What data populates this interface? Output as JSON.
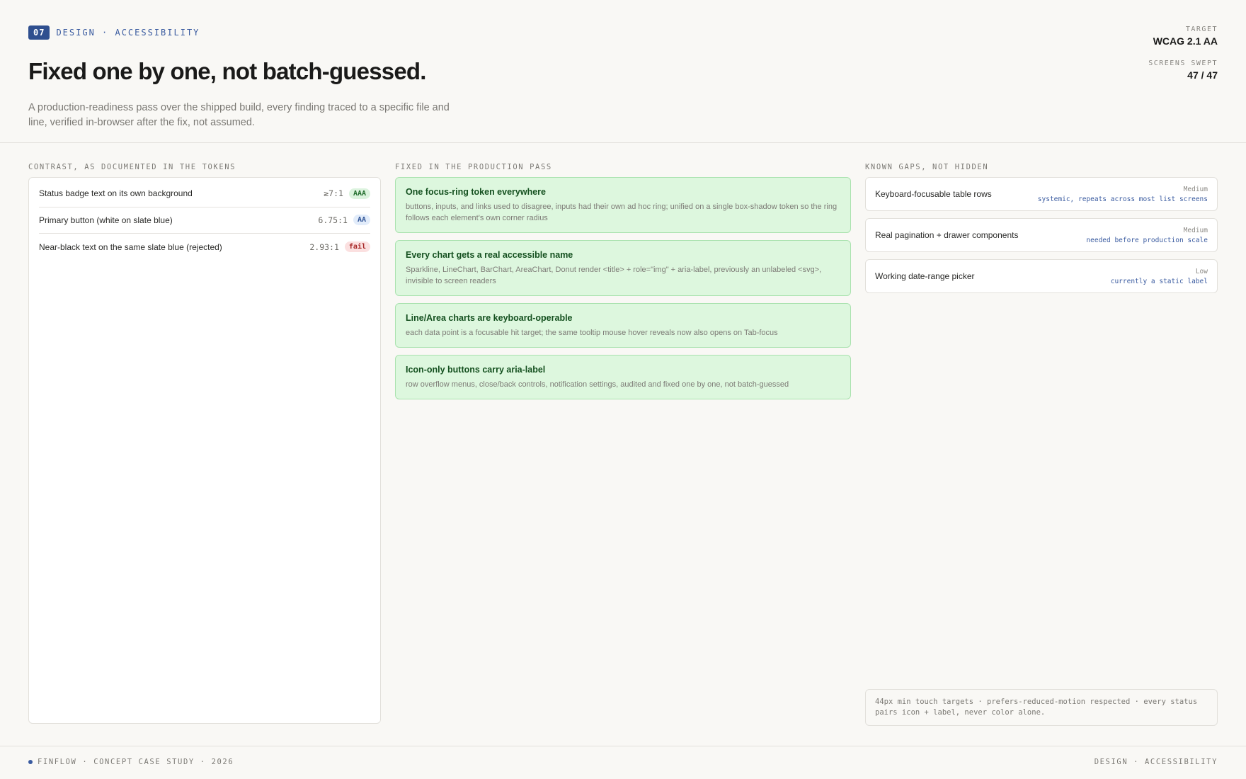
{
  "header": {
    "section_number": "07",
    "eyebrow": "DESIGN · ACCESSIBILITY",
    "title": "Fixed one by one, not batch-guessed.",
    "subtitle": "A production-readiness pass over the shipped build, every finding traced to a specific file and line, verified in-browser after the fix, not assumed.",
    "meta": [
      {
        "label": "TARGET",
        "value": "WCAG 2.1 AA"
      },
      {
        "label": "SCREENS SWEPT",
        "value": "47 / 47"
      }
    ]
  },
  "contrast": {
    "heading": "CONTRAST, AS DOCUMENTED IN THE TOKENS",
    "rows": [
      {
        "label": "Status badge text on its own background",
        "ratio": "≥7:1",
        "badge": "AAA",
        "status": "aaa"
      },
      {
        "label": "Primary button (white on slate blue)",
        "ratio": "6.75:1",
        "badge": "AA",
        "status": "aa"
      },
      {
        "label": "Near-black text on the same slate blue (rejected)",
        "ratio": "2.93:1",
        "badge": "fail",
        "status": "fail"
      }
    ]
  },
  "fixes": {
    "heading": "FIXED IN THE PRODUCTION PASS",
    "items": [
      {
        "title": "One focus-ring token everywhere",
        "desc": "buttons, inputs, and links used to disagree, inputs had their own ad hoc ring; unified on a single box-shadow token so the ring follows each element's own corner radius"
      },
      {
        "title": "Every chart gets a real accessible name",
        "desc": "Sparkline, LineChart, BarChart, AreaChart, Donut render <title> + role=\"img\" + aria-label, previously an unlabeled <svg>, invisible to screen readers"
      },
      {
        "title": "Line/Area charts are keyboard-operable",
        "desc": "each data point is a focusable hit target; the same tooltip mouse hover reveals now also opens on Tab-focus"
      },
      {
        "title": "Icon-only buttons carry aria-label",
        "desc": "row overflow menus, close/back controls, notification settings, audited and fixed one by one, not batch-guessed"
      }
    ]
  },
  "gaps": {
    "heading": "KNOWN GAPS, NOT HIDDEN",
    "items": [
      {
        "label": "Keyboard-focusable table rows",
        "level": "Medium",
        "note": "systemic, repeats across most list screens"
      },
      {
        "label": "Real pagination + drawer components",
        "level": "Medium",
        "note": "needed before production scale"
      },
      {
        "label": "Working date-range picker",
        "level": "Low",
        "note": "currently a static label"
      }
    ],
    "footnote": "44px min touch targets · prefers-reduced-motion respected · every status pairs icon + label, never color alone."
  },
  "footer": {
    "left": "FINFLOW · CONCEPT CASE STUDY · 2026",
    "right": "DESIGN · ACCESSIBILITY"
  },
  "colors": {
    "accent": "#2f4f8f",
    "fix_card_bg": "#ddf7de",
    "fix_title": "#14501f",
    "gap_note": "#3a5ba0"
  }
}
